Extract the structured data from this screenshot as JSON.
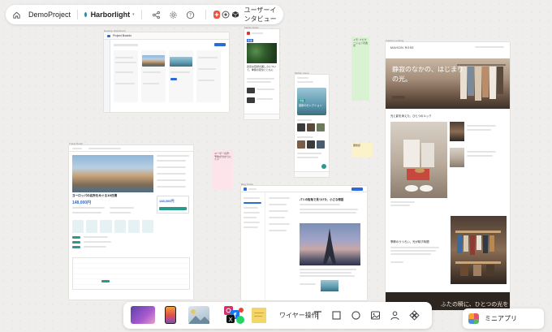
{
  "topbar": {
    "project_name": "DemoProject",
    "file_name": "Harborlight",
    "file_dot_color": "#2b8a9e",
    "chevron": "▾",
    "view_label": "ユーザーインタビュー",
    "icons": [
      "home-icon",
      "share-icon",
      "settings-icon",
      "help-icon",
      "app-icon-red",
      "app-icon-orbit",
      "app-icon-cube"
    ]
  },
  "frames": {
    "dashboard": {
      "title": "Desktop Dashboard",
      "header": "Project Boards"
    },
    "mobile_news": {
      "title": "Mobile Article",
      "tag": "新着",
      "headline": "身近な自然の美しさについて、季節の変化とともに"
    },
    "mobile_app": {
      "title": "Mobile Home",
      "hero_tag": "特集",
      "hero_title": "最新のセレクション"
    },
    "travel": {
      "title": "Travel Detail",
      "heading": "ヨーロッパの名所をめぐる10日間",
      "price": "148,000円",
      "side_price": "148,000円"
    },
    "article": {
      "title": "Blog Article",
      "heading": "パリの街角で見つけた、小さな物語"
    },
    "fashion": {
      "title": "Fashion Landing",
      "brand": "MAISON ROSE",
      "hero_line1": "静寂のなかの、はじまり",
      "hero_line2": "の光。",
      "section1": "光と影を添えた、ひとつのルック",
      "section2": "季節のうつろい、光が映す時間",
      "footer_line": "ふたの瞬に、ひとつの光を"
    }
  },
  "stickies": [
    {
      "color": "#d9f2d2",
      "text": "メモ: ナビゲーションの改善"
    },
    {
      "color": "#fde3ea",
      "text": "ユーザーの声: 予約が分かりにくい"
    },
    {
      "color": "#fbf2c9",
      "text": "要確認"
    }
  ],
  "toolbar": {
    "label": "ワイヤー操作",
    "tools": [
      "text-tool-icon",
      "rectangle-tool-icon",
      "ellipse-tool-icon",
      "image-tool-icon",
      "person-tool-icon",
      "component-tool-icon"
    ]
  },
  "mini_app": {
    "label": "ミニアプリ"
  }
}
